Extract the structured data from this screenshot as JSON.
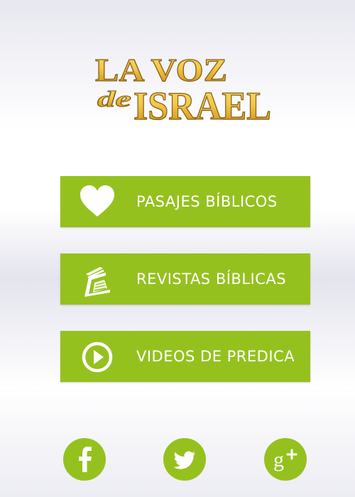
{
  "logo": {
    "line1": "LA VOZ",
    "word_de": "de",
    "word_israel": "ISRAEL",
    "gold_light": "#f6dc6c",
    "gold_mid": "#d9a628",
    "gold_dark": "#8a5a12"
  },
  "menu": {
    "items": [
      {
        "label": "PASAJES BÍBLICOS",
        "icon": "heart-icon"
      },
      {
        "label": "REVISTAS BÍBLICAS",
        "icon": "magazine-icon"
      },
      {
        "label": "VIDEOS DE PREDICA",
        "icon": "play-circle-icon"
      }
    ]
  },
  "social": {
    "items": [
      {
        "network": "facebook",
        "icon": "facebook-icon"
      },
      {
        "network": "twitter",
        "icon": "twitter-icon"
      },
      {
        "network": "google-plus",
        "icon": "google-plus-icon"
      }
    ]
  },
  "colors": {
    "accent": "#95c11f",
    "text_on_accent": "#ffffff"
  }
}
